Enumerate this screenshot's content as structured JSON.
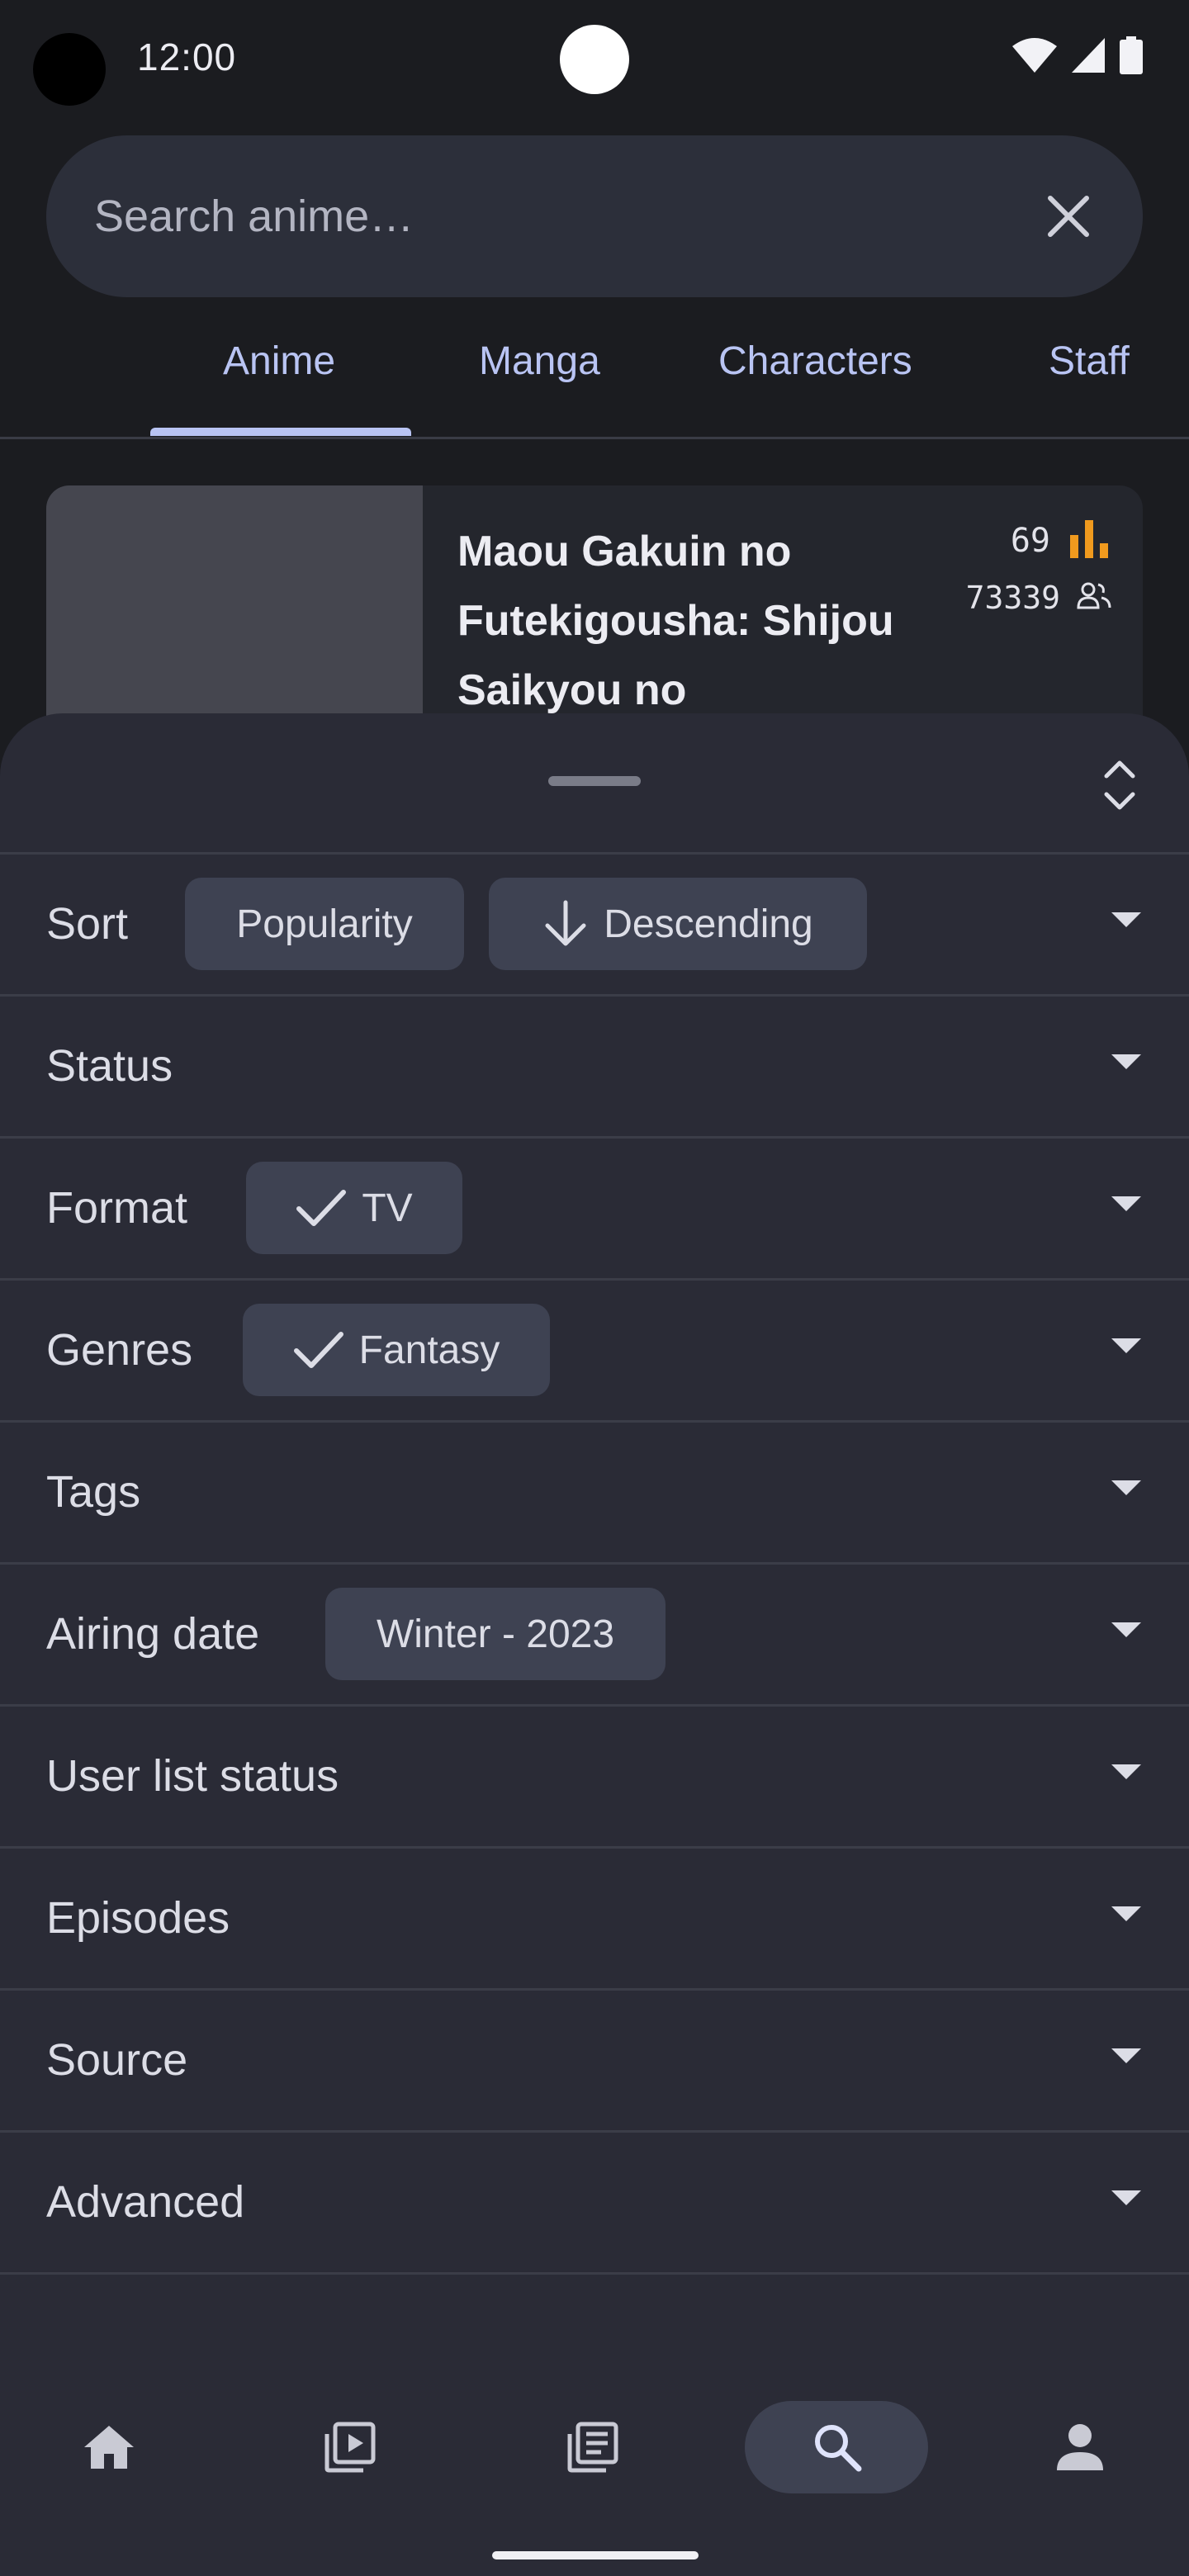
{
  "status_bar": {
    "time": "12:00"
  },
  "search": {
    "placeholder": "Search anime…"
  },
  "tabs": [
    {
      "label": "Anime",
      "selected": true
    },
    {
      "label": "Manga",
      "selected": false
    },
    {
      "label": "Characters",
      "selected": false
    },
    {
      "label": "Staff",
      "selected": false
    }
  ],
  "result": {
    "title": "Maou Gakuin no Futekigousha: Shijou Saikyou no",
    "score": "69",
    "users": "73339"
  },
  "filters": {
    "sort": {
      "label": "Sort",
      "chips": [
        "Popularity",
        "Descending"
      ]
    },
    "status": {
      "label": "Status"
    },
    "format": {
      "label": "Format",
      "chip": "TV"
    },
    "genres": {
      "label": "Genres",
      "chip": "Fantasy"
    },
    "tags": {
      "label": "Tags"
    },
    "airing_date": {
      "label": "Airing date",
      "chip": "Winter - 2023"
    },
    "user_list_status": {
      "label": "User list status"
    },
    "episodes": {
      "label": "Episodes"
    },
    "source": {
      "label": "Source"
    },
    "advanced": {
      "label": "Advanced"
    }
  },
  "bottom_nav": {
    "items": [
      "home-icon",
      "anime-icon",
      "manga-icon",
      "search-icon",
      "profile-icon"
    ],
    "selected": "search-icon"
  },
  "colors": {
    "accent": "#b9c4f3",
    "score_orange": "#f09a1e",
    "chip_bg": "#3e4252",
    "sheet_bg": "#2a2b36"
  }
}
